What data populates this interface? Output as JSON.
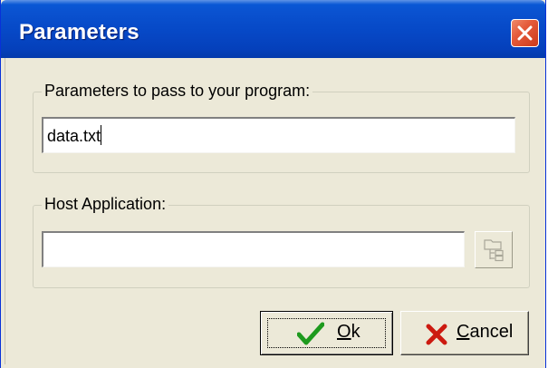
{
  "window": {
    "title": "Parameters"
  },
  "params_group": {
    "label": "Parameters to pass to your program:",
    "value": "data.txt"
  },
  "host_group": {
    "label": "Host Application:",
    "value": ""
  },
  "buttons": {
    "ok": {
      "mnemonic": "O",
      "rest": "k",
      "icon": "checkmark-icon"
    },
    "cancel": {
      "mnemonic": "C",
      "rest": "ancel",
      "icon": "red-x-icon"
    }
  },
  "colors": {
    "titlebar": "#0648c6",
    "close": "#e45a3a",
    "face": "#ece9d8",
    "ok_check": "#1e9a1e",
    "cancel_x": "#cc1a10"
  }
}
